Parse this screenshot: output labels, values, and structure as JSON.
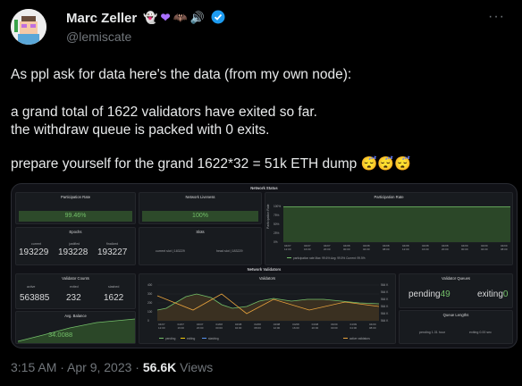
{
  "author": {
    "name": "Marc Zeller",
    "name_emojis": [
      "ghost-emoji",
      "purple-heart-emoji",
      "bat-emoji",
      "speaker-emoji",
      "verified-badge"
    ],
    "handle": "@lemiscate"
  },
  "tweet": {
    "line1": "As ppl ask for data here's the data (from my own node):",
    "line2": "a grand total of 1622 validators have exited so far.",
    "line3": "the withdraw queue is packed with 0 exits.",
    "line4": "prepare yourself for the grand 1622*32 = 51k ETH dump",
    "line4_emojis": [
      "sleeping-face-emoji",
      "sleeping-face-emoji",
      "sleeping-face-emoji"
    ]
  },
  "dashboard": {
    "section_status": "Network Status",
    "section_validators": "Network Validators",
    "participation_rate": {
      "title": "Participation Rate",
      "value": "99.46%"
    },
    "network_liveness": {
      "title": "Network Liveness",
      "value": "100%"
    },
    "participation_chart": {
      "title": "Participation Rate",
      "ylabel": "Participation Rate",
      "yticks": [
        "100%",
        "75%",
        "50%",
        "25%",
        "0%"
      ],
      "xticks": [
        "04/07\n12:00",
        "04/07\n16:00",
        "04/07\n20:00",
        "04/08\n00:00",
        "04/08\n04:00",
        "04/08\n08:00",
        "04/08\n12:00",
        "04/08\n16:00",
        "04/08\n20:00",
        "04/09\n00:00",
        "04/09\n04:00",
        "04/09\n08:00"
      ],
      "legend": "participation rate   Max: 99.6%   Avg: 99.5%   Current: 99.5%"
    },
    "epochs": {
      "title": "Epochs",
      "labels": [
        "current",
        "justified",
        "finalized"
      ],
      "values": [
        "193229",
        "193228",
        "193227"
      ]
    },
    "slots": {
      "title": "Slots",
      "current": "current slot | 183229",
      "head": "head slot | 183229"
    },
    "validator_counts": {
      "title": "Validator Counts",
      "labels": [
        "active",
        "exited",
        "slashed"
      ],
      "values": [
        "563885",
        "232",
        "1622"
      ]
    },
    "avg_balance": {
      "title": "Avg. Balance",
      "value": "34.0088"
    },
    "validators_chart": {
      "title": "Validators",
      "yticks": [
        "400",
        "300",
        "200",
        "100",
        "0"
      ],
      "yticks_right": [
        "564 K",
        "564 K",
        "564 K",
        "564 K",
        "564 K",
        "564 K"
      ],
      "legend": [
        "pending",
        "exiting",
        "slashing",
        "active validators"
      ]
    },
    "validator_queues": {
      "title": "Validator Queues",
      "pending_label": "pending",
      "pending_value": "49",
      "exiting_label": "exiting",
      "exiting_value": "0"
    },
    "queue_lengths": {
      "title": "Queue Lengths",
      "left": "pending 1.31 hour",
      "right": "exiting 0.00 sec"
    }
  },
  "footer": {
    "time": "3:15 AM · Apr 9, 2023 · ",
    "views": "56.6K",
    "views_label": " Views"
  },
  "colors": {
    "background": "#000000",
    "green": "#73bf69",
    "text": "#e7e9ea",
    "muted": "#71767b",
    "verified": "#1d9bf0"
  }
}
